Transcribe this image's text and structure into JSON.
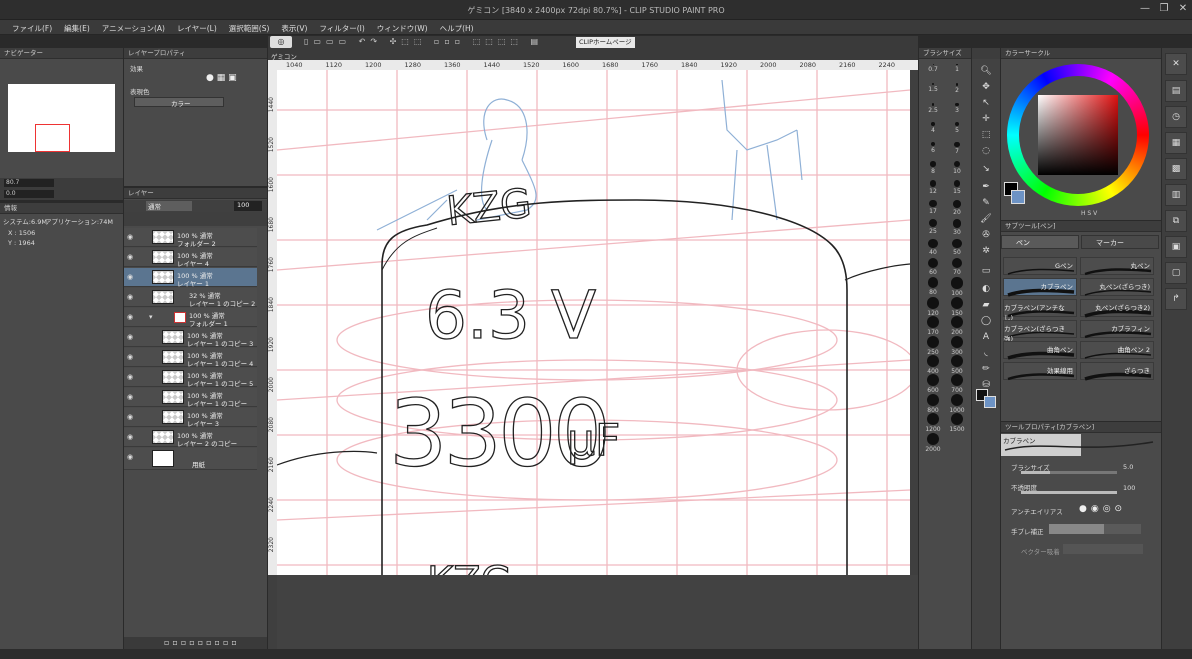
{
  "title": "ゲミコン [3840 x 2400px 72dpi 80.7%] - CLIP STUDIO PAINT PRO",
  "menu": [
    "ファイル(F)",
    "編集(E)",
    "アニメーション(A)",
    "レイヤー(L)",
    "選択範囲(S)",
    "表示(V)",
    "フィルター(I)",
    "ウィンドウ(W)",
    "ヘルプ(H)"
  ],
  "toolbar": {
    "clip_home": "CLIPホームページ"
  },
  "navigator": {
    "tab": "ナビゲーター",
    "zoom": "80.7",
    "angle": "0.0"
  },
  "layer_property": {
    "tab": "レイヤープロパティ",
    "effect": "効果",
    "expression_color": "表現色",
    "color_mode": "カラー"
  },
  "info": {
    "tab": "情報",
    "system": "システム:6.9M",
    "app": "アプリケーション:74M",
    "x": "X : 1506",
    "y": "Y : 1964"
  },
  "layers": {
    "tab": "レイヤー",
    "blend": "通常",
    "opacity": "100",
    "items": [
      {
        "l1": "100 % 通常",
        "l2": "フォルダー 2"
      },
      {
        "l1": "100 % 通常",
        "l2": "レイヤー 4"
      },
      {
        "l1": "100 % 通常",
        "l2": "レイヤー 1"
      },
      {
        "l1": "32 % 通常",
        "l2": "レイヤー 1 のコピー 2"
      },
      {
        "l1": "100 % 通常",
        "l2": "フォルダー 1"
      },
      {
        "l1": "100 % 通常",
        "l2": "レイヤー 1 のコピー 3"
      },
      {
        "l1": "100 % 通常",
        "l2": "レイヤー 1 のコピー 4"
      },
      {
        "l1": "100 % 通常",
        "l2": "レイヤー 1 のコピー 5"
      },
      {
        "l1": "100 % 通常",
        "l2": "レイヤー 1 のコピー"
      },
      {
        "l1": "100 % 通常",
        "l2": "レイヤー 3"
      },
      {
        "l1": "100 % 通常",
        "l2": "レイヤー 2 のコピー"
      },
      {
        "l1": "",
        "l2": "用紙"
      }
    ]
  },
  "canvas": {
    "tab": "ゲミコン",
    "ruler_h": [
      "1040",
      "1120",
      "1200",
      "1280",
      "1360",
      "1440",
      "1520",
      "1600",
      "1680",
      "1760",
      "1840",
      "1920",
      "2000",
      "2080",
      "2160",
      "2240"
    ],
    "ruler_v": [
      "1440",
      "1520",
      "1600",
      "1680",
      "1760",
      "1840",
      "1920",
      "2000",
      "2080",
      "2160",
      "2240",
      "2320"
    ],
    "text_63v": "6.3 V",
    "text_3300": "3300",
    "text_uf": "μF",
    "text_top": "KZG",
    "text_bottom": "KZG"
  },
  "brush_size": {
    "tab": "ブラシサイズ",
    "sizes": [
      "0.7",
      "1",
      "1.5",
      "2",
      "2.5",
      "3",
      "4",
      "5",
      "6",
      "7",
      "8",
      "10",
      "12",
      "15",
      "17",
      "20",
      "25",
      "30",
      "40",
      "50",
      "60",
      "70",
      "80",
      "100",
      "120",
      "150",
      "170",
      "200",
      "250",
      "300",
      "400",
      "500",
      "600",
      "700",
      "800",
      "1000",
      "1200",
      "1500",
      "2000"
    ]
  },
  "color_circle": {
    "tab": "カラーサークル",
    "hsv": "H S V"
  },
  "sub_tool": {
    "tab": "サブツール[ペン]",
    "group_pen": "ペン",
    "group_marker": "マーカー",
    "brushes": [
      "Gペン",
      "丸ペン",
      "カブラペン",
      "丸ペン(ざらつき)",
      "カブラペン(アンチなし)",
      "丸ペン(ざらつき2)",
      "カブラペン(ざらつき強)",
      "カブラフィン",
      "曲角ペン",
      "曲角ペン 2",
      "効果線用",
      "ざらつき"
    ]
  },
  "tool_property": {
    "tab": "ツールプロパティ[カブラペン]",
    "brush_name": "カブラペン",
    "brush_size_label": "ブラシサイズ",
    "brush_size_value": "5.0",
    "opacity_label": "不透明度",
    "opacity_value": "100",
    "antialias_label": "アンチエイリアス",
    "stabilization_label": "手ブレ補正",
    "vector_label": "ベクター吸着"
  }
}
